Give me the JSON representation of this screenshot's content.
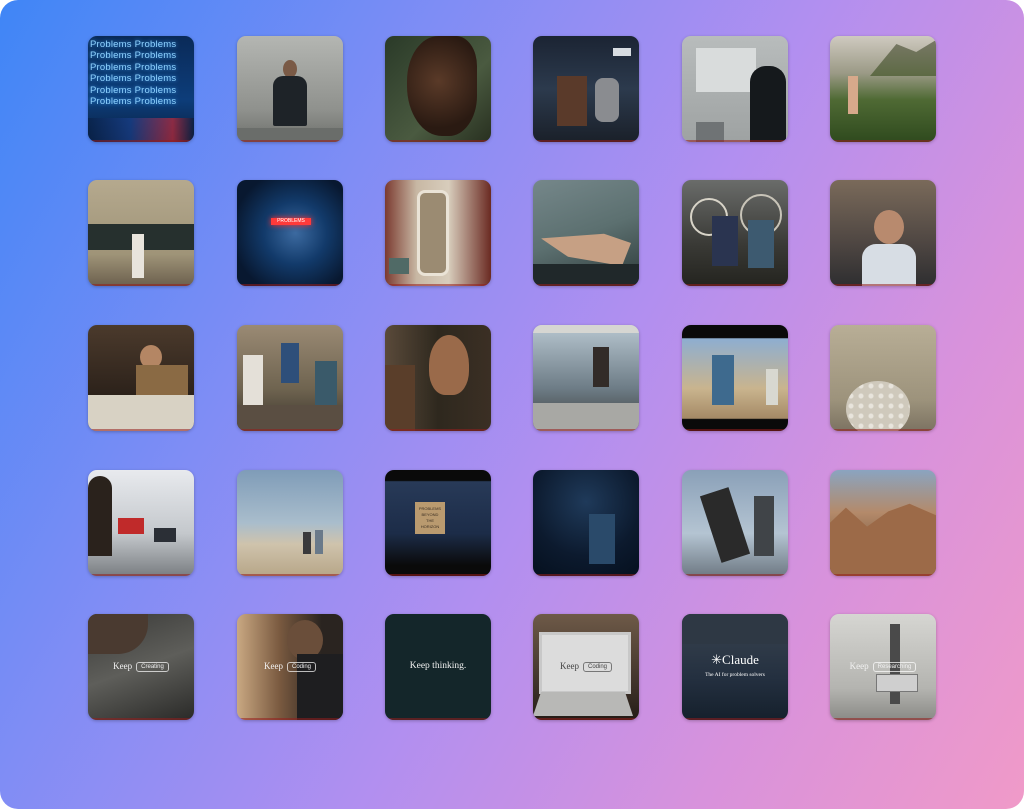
{
  "tiles": {
    "r1c1": {
      "lines": [
        "Problems Problems",
        "Problems Problems",
        "Problems Problems",
        "Problems Problems",
        "Problems Problems",
        "Problems Problems"
      ]
    },
    "r2c2": {
      "banner": "PROBLEMS"
    },
    "r4c3": {
      "sign_lines": [
        "PROBLEMS",
        "BEYOND",
        "THE",
        "HORIZON"
      ]
    },
    "r5c1": {
      "caption": "Keep",
      "pill": "Creating"
    },
    "r5c2": {
      "caption": "Keep",
      "pill": "Coding"
    },
    "r5c3": {
      "caption": "Keep thinking."
    },
    "r5c4": {
      "caption": "Keep",
      "pill": "Coding"
    },
    "r5c5": {
      "brand": "Claude",
      "tagline": "The AI for problem solvers"
    },
    "r5c6": {
      "caption": "Keep",
      "pill": "Researching"
    }
  },
  "colors": {
    "gradient_start": "#3f86f6",
    "gradient_end": "#f09ac8"
  }
}
